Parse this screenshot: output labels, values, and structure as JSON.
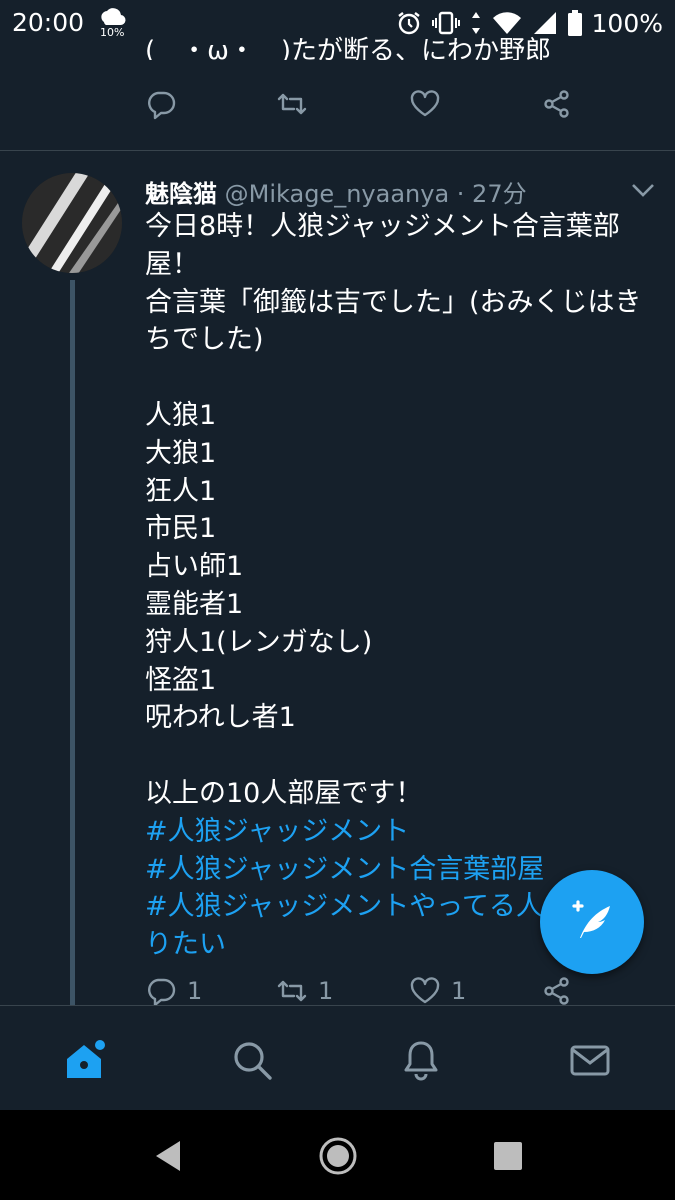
{
  "status_bar": {
    "time": "20:00",
    "weather_percent": "10%",
    "battery_text": "100%",
    "icons": [
      "weather-icon",
      "alarm-icon",
      "vibrate-icon",
      "data-arrows-icon",
      "wifi-icon",
      "signal-icon",
      "battery-icon"
    ]
  },
  "previous_tweet": {
    "fragment_text": "(　・ω・　)たが断る、にわか野郎",
    "reply_count": "",
    "retweet_count": "",
    "like_count": ""
  },
  "tweet": {
    "display_name": "魅陰猫",
    "handle": "@Mikage_nyaanya",
    "time": " · 27分",
    "lines": [
      "今日8時！人狼ジャッジメント合言葉部",
      "屋！",
      "合言葉「御籤は吉でした」(おみくじはき",
      "ちでした)",
      "",
      "人狼1",
      "大狼1",
      "狂人1",
      "市民1",
      "占い師1",
      "霊能者1",
      "狩人1(レンガなし)",
      "怪盗1",
      "呪われし者1",
      "",
      "以上の10人部屋です！"
    ],
    "hashtags": [
      "#人狼ジャッジメント",
      "#人狼ジャッジメント合言葉部屋",
      "#人狼ジャッジメントやってる人と繋が",
      "りたい"
    ],
    "reply_count": "1",
    "retweet_count": "1",
    "like_count": "1"
  },
  "tabs": [
    {
      "name": "home",
      "icon": "home-icon",
      "active": true
    },
    {
      "name": "search",
      "icon": "search-icon",
      "active": false
    },
    {
      "name": "notifications",
      "icon": "bell-icon",
      "active": false
    },
    {
      "name": "messages",
      "icon": "mail-icon",
      "active": false
    }
  ],
  "colors": {
    "background": "#15202b",
    "accent": "#1da1f2",
    "secondary_text": "#8899a6",
    "divider": "#38444d"
  }
}
